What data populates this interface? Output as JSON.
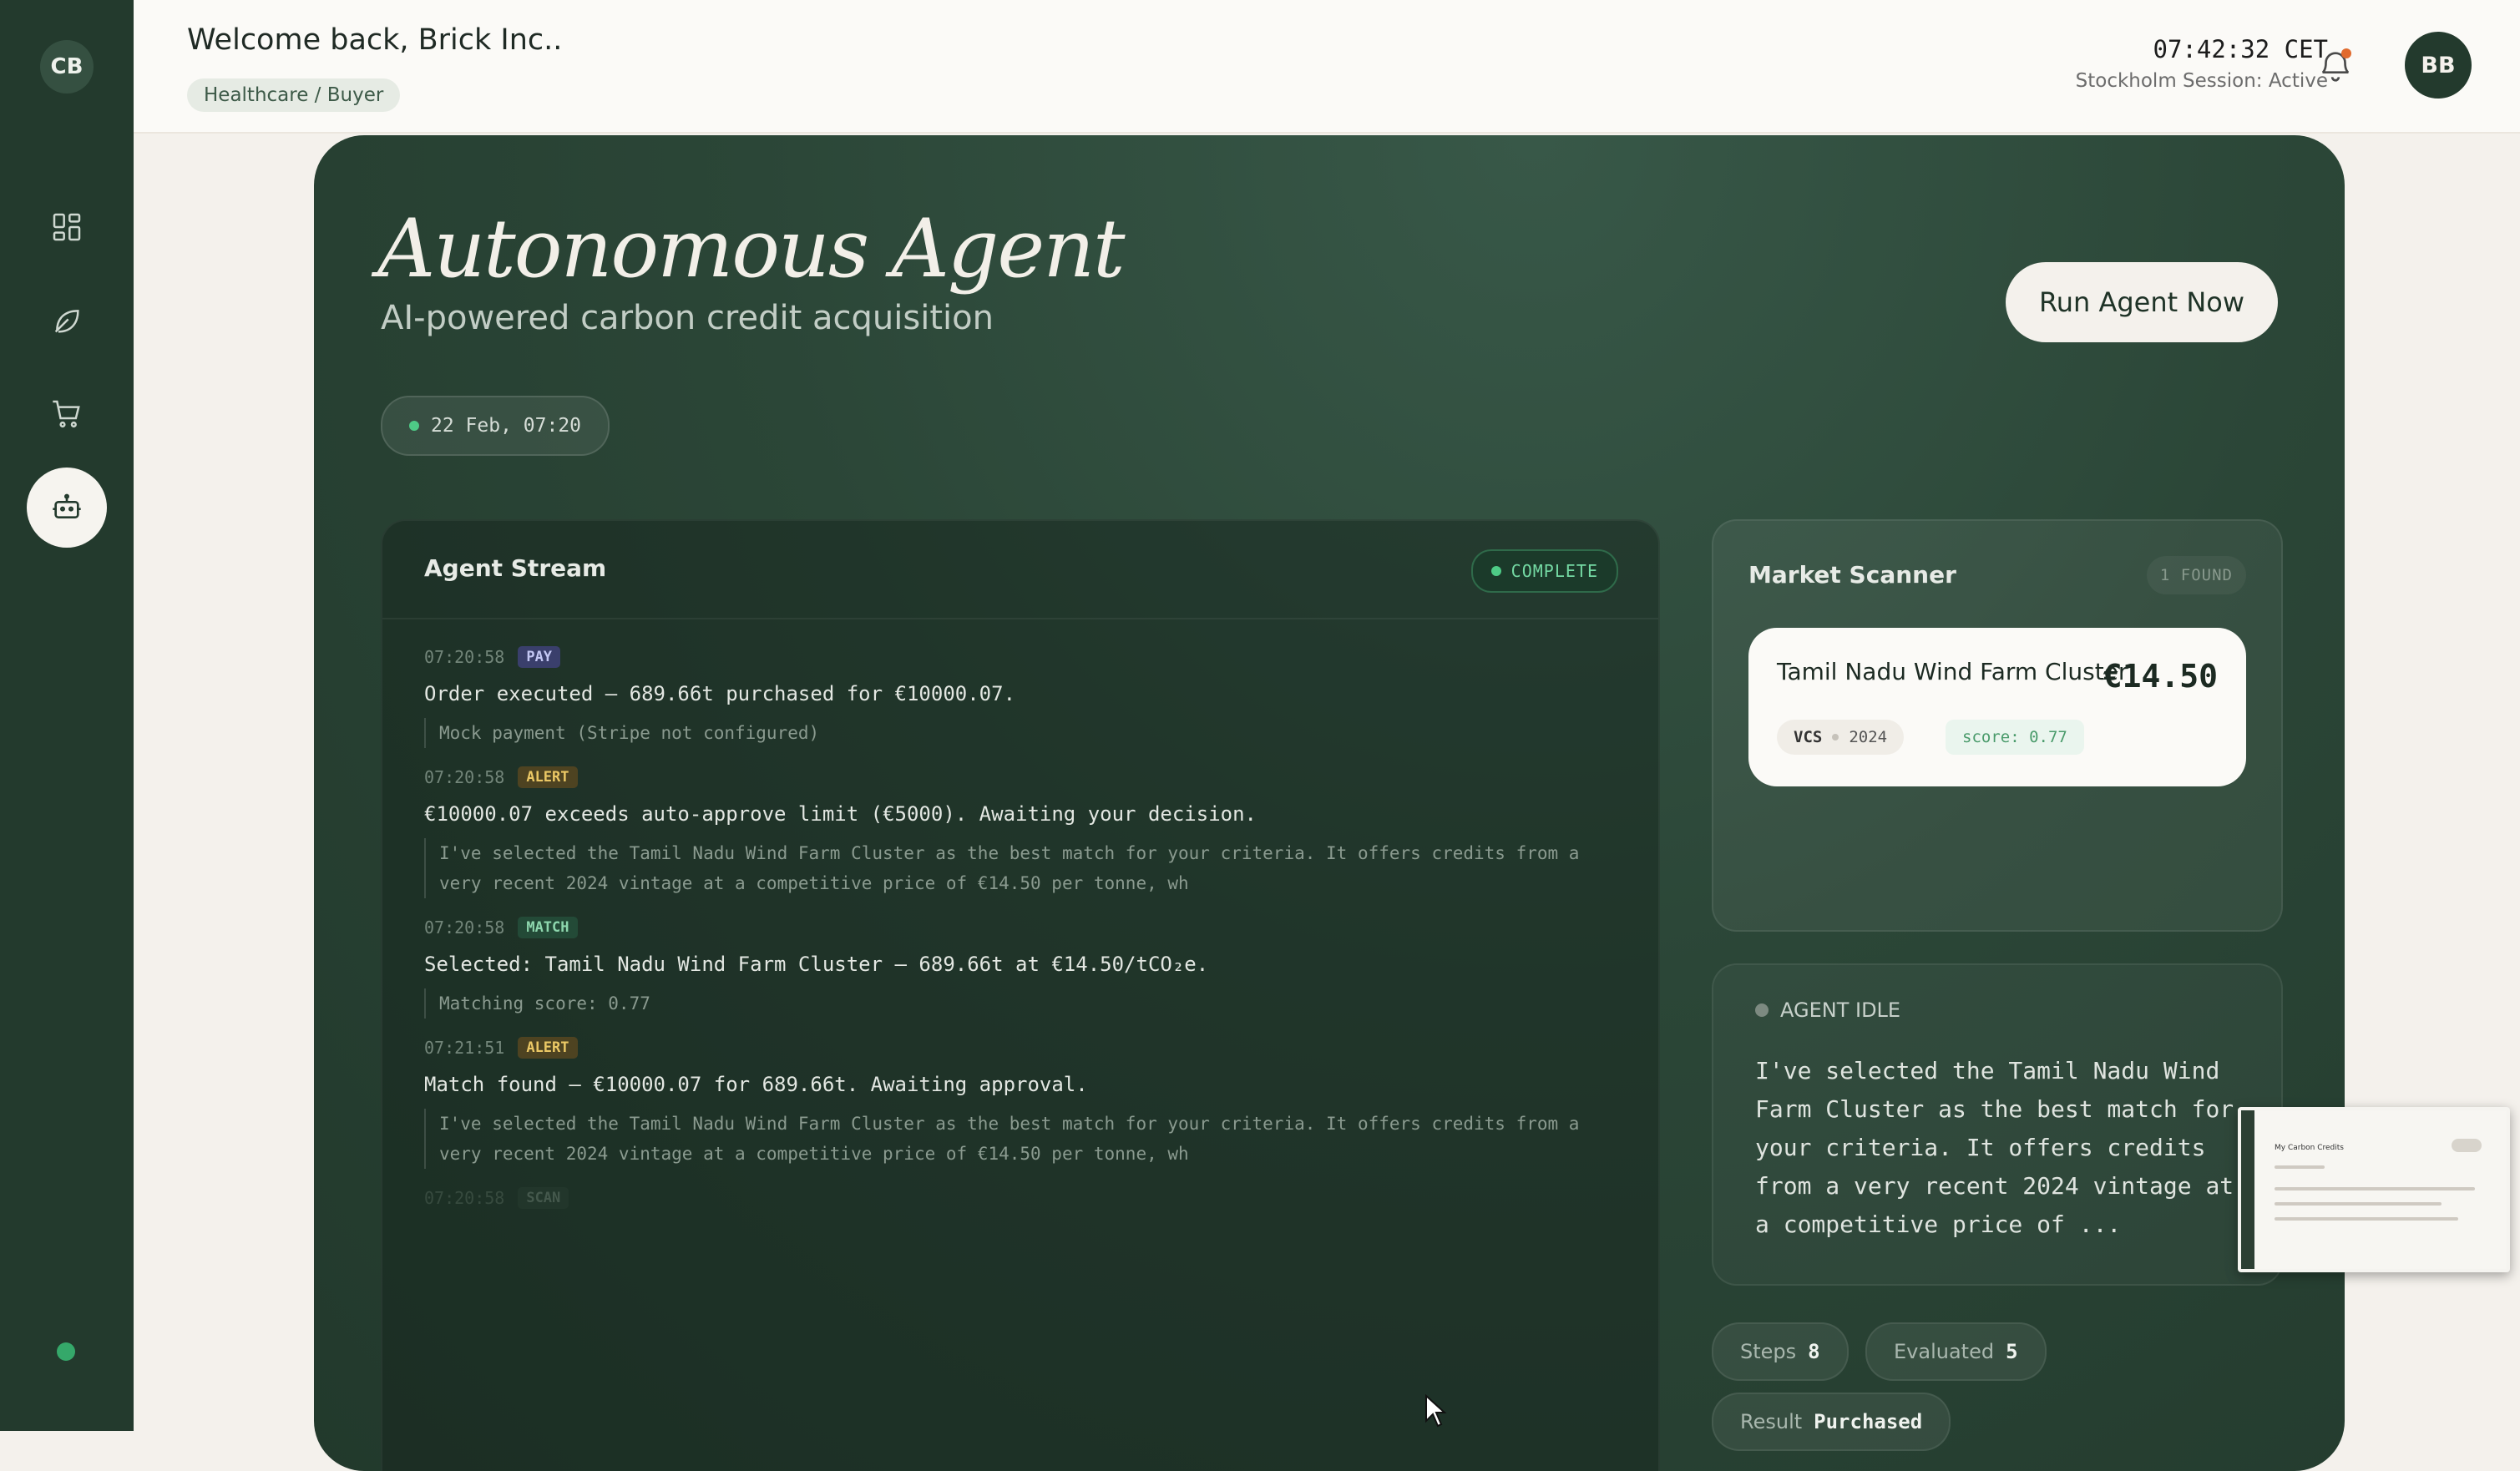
{
  "sidebar": {
    "avatar_initials": "CB",
    "items": [
      {
        "icon": "grid-icon",
        "label": "dashboard"
      },
      {
        "icon": "leaf-icon",
        "label": "credits"
      },
      {
        "icon": "cart-icon",
        "label": "marketplace"
      },
      {
        "icon": "robot-icon",
        "label": "agent",
        "active": true
      }
    ],
    "status_color": "#35a86a"
  },
  "header": {
    "welcome": "Welcome back, Brick Inc..",
    "role": "Healthcare / Buyer",
    "clock": "07:42:32 CET",
    "session": "Stockholm Session: Active",
    "user_initials": "BB"
  },
  "hero": {
    "title": "Autonomous Agent",
    "subtitle": "AI-powered carbon credit acquisition",
    "run_button": "Run Agent Now",
    "date": "22 Feb, 07:20"
  },
  "stream": {
    "title": "Agent Stream",
    "status": "COMPLETE",
    "entries": [
      {
        "time": "07:20:58",
        "tag": "PAY",
        "message": "Order executed — 689.66t purchased for €10000.07.",
        "note": "Mock payment (Stripe not configured)"
      },
      {
        "time": "07:20:58",
        "tag": "ALERT",
        "message": "€10000.07 exceeds auto-approve limit (€5000). Awaiting your decision.",
        "note": "I've selected the Tamil Nadu Wind Farm Cluster as the best match for your criteria. It offers credits from a very recent 2024 vintage at a competitive price of €14.50 per tonne, wh"
      },
      {
        "time": "07:20:58",
        "tag": "MATCH",
        "message": "Selected: Tamil Nadu Wind Farm Cluster — 689.66t at €14.50/tCO₂e.",
        "note": "Matching score: 0.77"
      },
      {
        "time": "07:21:51",
        "tag": "ALERT",
        "message": "Match found — €10000.07 for 689.66t. Awaiting approval.",
        "note": "I've selected the Tamil Nadu Wind Farm Cluster as the best match for your criteria. It offers credits from a very recent 2024 vintage at a competitive price of €14.50 per tonne, wh"
      },
      {
        "time": "07:20:58",
        "tag": "SCAN"
      }
    ]
  },
  "scanner": {
    "title": "Market Scanner",
    "found": "1 FOUND",
    "card": {
      "name": "Tamil Nadu Wind Farm Cluster",
      "price": "€14.50",
      "standard": "VCS",
      "vintage": "2024",
      "score": "score: 0.77"
    }
  },
  "idle": {
    "status": "AGENT IDLE",
    "text": "I've selected the Tamil Nadu Wind Farm Cluster as the best match for your criteria. It offers credits from a very recent 2024 vintage at a competitive price of ..."
  },
  "stats": {
    "steps_label": "Steps",
    "steps_value": "8",
    "evaluated_label": "Evaluated",
    "evaluated_value": "5",
    "result_label": "Result",
    "result_value": "Purchased"
  },
  "thumbnail": {
    "caption": "My Carbon Credits"
  }
}
